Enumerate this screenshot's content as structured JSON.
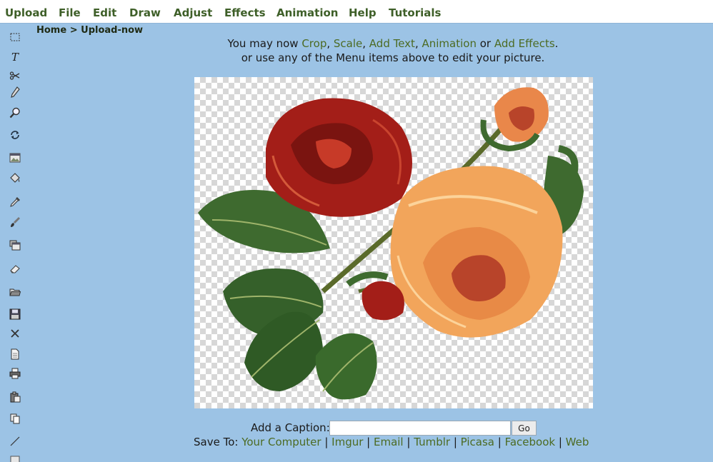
{
  "menu": {
    "items": [
      "Upload",
      "File",
      "Edit",
      "Draw",
      "Adjust",
      "Effects",
      "Animation",
      "Help",
      "Tutorials"
    ]
  },
  "breadcrumb": {
    "home": "Home",
    "separator": " > ",
    "current": "Upload-now"
  },
  "toolbar": {
    "tools": [
      "select-icon",
      "text-icon",
      "scissors-icon",
      "pencil-icon",
      "zoom-icon",
      "rotate-icon",
      "image-icon",
      "paint-bucket-icon",
      "eyedropper-icon",
      "brush-icon",
      "layers-icon",
      "eraser-icon",
      "open-folder-icon",
      "save-icon",
      "close-icon",
      "new-document-icon",
      "print-icon",
      "paste-icon",
      "copy-icon",
      "line-icon",
      "frame-icon"
    ]
  },
  "intro": {
    "line1_prefix": "You may now ",
    "crop": "Crop",
    "comma1": ", ",
    "scale": "Scale",
    "comma2": ", ",
    "add_text": "Add Text",
    "comma3": ", ",
    "animation": "Animation",
    "or": " or ",
    "add_effects": "Add Effects",
    "period": ".",
    "line2": "or use any of the Menu items above to edit your picture."
  },
  "caption": {
    "label": "Add a Caption:",
    "value": "",
    "go": "Go"
  },
  "save": {
    "label": "Save To: ",
    "separator": " | ",
    "targets": [
      "Your Computer",
      "Imgur",
      "Email",
      "Tumblr",
      "Picasa",
      "Facebook",
      "Web"
    ]
  },
  "colors": {
    "background": "#9cc3e5",
    "menu_text": "#3e5f28",
    "link": "#4c6b23",
    "rose_red": "#a31e18",
    "rose_peach": "#f2a55b",
    "leaf_green": "#3e6a2f"
  }
}
